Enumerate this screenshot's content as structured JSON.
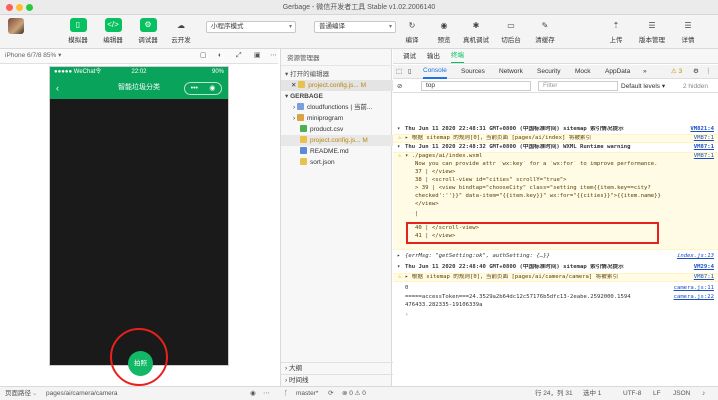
{
  "window": {
    "title": "Gerbage - 微信开发者工具 Stable v1.02.2006140"
  },
  "toolbar": {
    "buttons": [
      {
        "label": "模拟器"
      },
      {
        "label": "编辑器"
      },
      {
        "label": "调试器"
      },
      {
        "label": "云开发"
      }
    ],
    "mode_select": "小程序模式",
    "compile_select": "普通编译",
    "actions": [
      {
        "label": "编译"
      },
      {
        "label": "预览"
      },
      {
        "label": "真机调试"
      },
      {
        "label": "切后台"
      },
      {
        "label": "清缓存"
      }
    ],
    "right": [
      {
        "label": "上传"
      },
      {
        "label": "版本管理"
      },
      {
        "label": "详情"
      }
    ]
  },
  "simulator": {
    "device": "iPhone 6/7/8 85% ▾",
    "status_left": "●●●●● WeChat令",
    "status_time": "22:02",
    "status_right": "90%",
    "nav_title": "智能垃圾分类",
    "capsule_more": "•••",
    "capsule_close": "◉",
    "shoot_label": "拍照"
  },
  "bottom": {
    "path_label": "页面路径",
    "path": "pages/ai/camera/camera",
    "branch": "master*",
    "position": "行 24，列 31",
    "select": "选中 1",
    "encoding": "UTF-8",
    "eol": "LF",
    "lang": "JSON"
  },
  "explorer": {
    "header": "资源管理器",
    "open_editors": "打开的编辑器",
    "open_file": "project.config.js...",
    "project": "GERBAGE",
    "files": [
      {
        "name": "cloudfunctions | 当前...",
        "type": "folder"
      },
      {
        "name": "miniprogram",
        "type": "folder"
      },
      {
        "name": "product.csv",
        "type": "csv"
      },
      {
        "name": "project.config.js...",
        "type": "json",
        "badge": "M"
      },
      {
        "name": "README.md",
        "type": "md"
      },
      {
        "name": "sort.json",
        "type": "json"
      }
    ],
    "outline": "大纲",
    "timeline": "时间线"
  },
  "devtools": {
    "top_tabs": [
      "调试",
      "输出",
      "终端"
    ],
    "tabs": [
      "Console",
      "Sources",
      "Network",
      "Security",
      "Mock",
      "AppData"
    ],
    "more": "»",
    "warn_count": "⚠ 3",
    "filter_context": "top",
    "filter_placeholder": "Filter",
    "levels": "Default levels ▾",
    "hidden": "2 hidden",
    "logs": [
      {
        "text": "Thu Jun 11 2020 22:48:31 GMT+0800 (中国标准时间) sitemap 索引情况提示",
        "src": "VM821:4",
        "type": "group"
      },
      {
        "text": "根据 sitemap 的规则[0]，当前页面 [pages/ai/index] 将被索引",
        "src": "VM87:1",
        "type": "warn"
      },
      {
        "text": "Thu Jun 11 2020 22:48:32 GMT+0800 (中国标准时间) WXML Runtime warning",
        "src": "VM87:1",
        "type": "group"
      },
      {
        "text": "./pages/ai/index.wxml",
        "src": "VM87:1",
        "type": "warn"
      },
      {
        "text": "Now you can provide attr `wx:key` for a `wx:for` to improve performance.",
        "src": "",
        "type": "warn"
      },
      {
        "text": "  37 |     </view>",
        "src": "",
        "type": "warn"
      },
      {
        "text": "  38 |     <scroll-view id=\"cities\" scrollY=\"true\">",
        "src": "",
        "type": "warn"
      },
      {
        "text": "> 39 |       <view bindtap=\"chooseCity\" class=\"setting item{{item.key==city?",
        "src": "",
        "type": "warn"
      },
      {
        "text": "checked':''}}\" data-item=\"{{item.key}}\" wx:for=\"{{cities}}\">{{item.name}}",
        "src": "",
        "type": "warn"
      },
      {
        "text": "</view>",
        "src": "",
        "type": "warn"
      },
      {
        "text": "     |",
        "src": "",
        "type": "warn"
      },
      {
        "text": "  40 |     </scroll-view>",
        "src": "",
        "type": "warn"
      },
      {
        "text": "  41 | </view>",
        "src": "",
        "type": "warn"
      },
      {
        "text": "{errMsg: \"getSetting:ok\", authSetting: {…}}",
        "src": "index.js:13",
        "type": "info"
      },
      {
        "text": "Thu Jun 11 2020 22:48:40 GMT+0800 (中国标准时间) sitemap 索引情况提示",
        "src": "VM29:4",
        "type": "group"
      },
      {
        "text": "根据 sitemap 的规则[0]，当前页面 [pages/ai/camera/camera] 将被索引",
        "src": "VM87:1",
        "type": "warn"
      },
      {
        "text": "0",
        "src": "camera.js:11",
        "type": "info"
      },
      {
        "text": "=====accessToken===24.3529a2b64dc12c57176b5dfc13-2eabe.2592000.1594",
        "src": "camera.js:22",
        "type": "info"
      },
      {
        "text": "476433.282335-19106339a",
        "src": "",
        "type": "info"
      }
    ]
  }
}
